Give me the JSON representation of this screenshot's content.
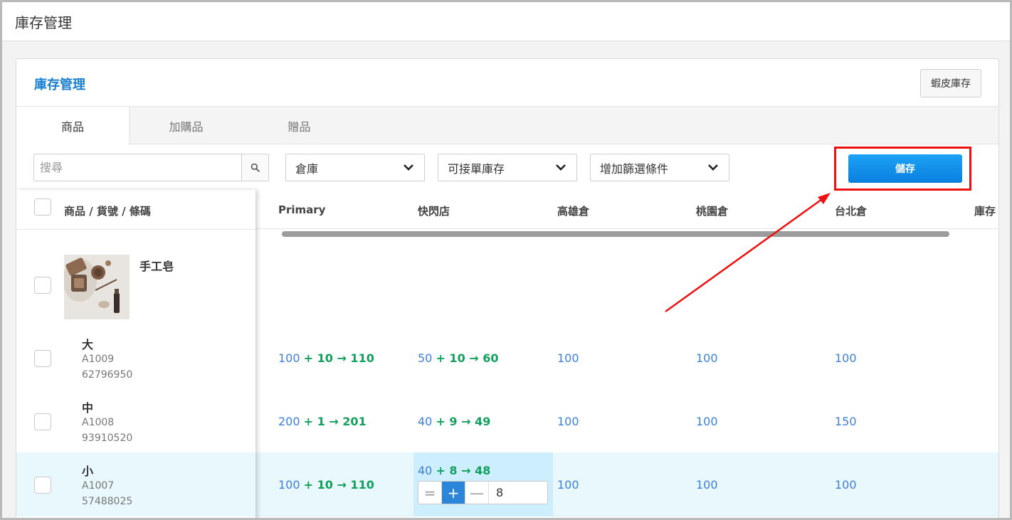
{
  "page": {
    "title": "庫存管理"
  },
  "card": {
    "title": "庫存管理",
    "shopee_label": "蝦皮庫存"
  },
  "tabs": [
    {
      "label": "商品",
      "active": true
    },
    {
      "label": "加購品",
      "active": false
    },
    {
      "label": "贈品",
      "active": false
    }
  ],
  "filters": {
    "search_placeholder": "搜尋",
    "warehouse": "倉庫",
    "stock_type": "可接單庫存",
    "add_filter": "增加篩選條件"
  },
  "save_label": "儲存",
  "columns": [
    "商品 / 貨號 / 條碼",
    "Primary",
    "快閃店",
    "高雄倉",
    "桃園倉",
    "台北倉",
    "庫存"
  ],
  "product": {
    "name": "手工皂"
  },
  "rows": [
    {
      "variant": "大",
      "sku": "A1009",
      "barcode": "62796950",
      "primary": {
        "base": "100",
        "add": "+ 10 → 110"
      },
      "flash": {
        "base": "50",
        "add": "+ 10 → 60"
      },
      "kaohsiung": "100",
      "taoyuan": "100",
      "taipei": "100"
    },
    {
      "variant": "中",
      "sku": "A1008",
      "barcode": "93910520",
      "primary": {
        "base": "200",
        "add": "+ 1 → 201"
      },
      "flash": {
        "base": "40",
        "add": "+ 9 → 49"
      },
      "kaohsiung": "100",
      "taoyuan": "100",
      "taipei": "150"
    },
    {
      "variant": "小",
      "sku": "A1007",
      "barcode": "57488025",
      "primary": {
        "base": "100",
        "add": "+ 10 → 110"
      },
      "flash": {
        "base": "40",
        "add": "+ 8 → 48"
      },
      "kaohsiung": "100",
      "taoyuan": "100",
      "taipei": "100"
    }
  ],
  "editor": {
    "mode_set": "=",
    "mode_add": "+",
    "mode_sub": "—",
    "value": "8",
    "active_mode": "add"
  },
  "colors": {
    "accent_blue": "#1a7fd1",
    "value_blue": "#3d7fd9",
    "delta_green": "#12a05c",
    "highlight_red": "#ee1111"
  }
}
